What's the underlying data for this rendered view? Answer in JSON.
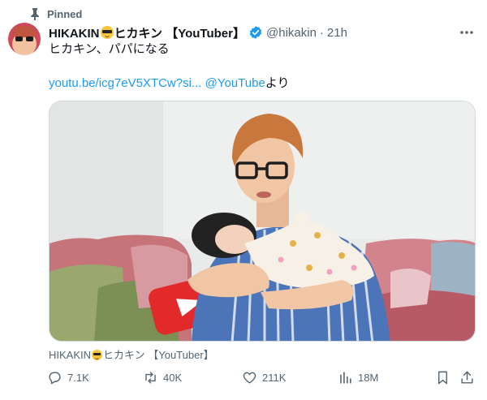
{
  "pinned": {
    "label": "Pinned"
  },
  "author": {
    "name_prefix": "HIKAKIN",
    "name_suffix": "ヒカキン 【YouTuber】",
    "handle": "@hikakin",
    "separator": "·",
    "time": "21h"
  },
  "tweet": {
    "text": "ヒカキン、パパになる",
    "link": "youtu.be/icg7eV5XTCw?si...",
    "mention": "@YouTube",
    "suffix": "より"
  },
  "media": {
    "caption_prefix": "HIKAKIN",
    "caption_suffix": "ヒカキン 【YouTuber】"
  },
  "actions": {
    "replies": "7.1K",
    "reposts": "40K",
    "likes": "211K",
    "views": "18M"
  },
  "icons": {
    "pin": "pin-icon",
    "verified": "verified-badge-icon",
    "more": "more-icon",
    "reply": "reply-icon",
    "repost": "repost-icon",
    "like": "heart-icon",
    "views": "views-chart-icon",
    "bookmark": "bookmark-icon",
    "share": "share-icon"
  },
  "colors": {
    "accent": "#1d9bf0",
    "secondary_text": "#536471",
    "primary_text": "#0f1419"
  }
}
